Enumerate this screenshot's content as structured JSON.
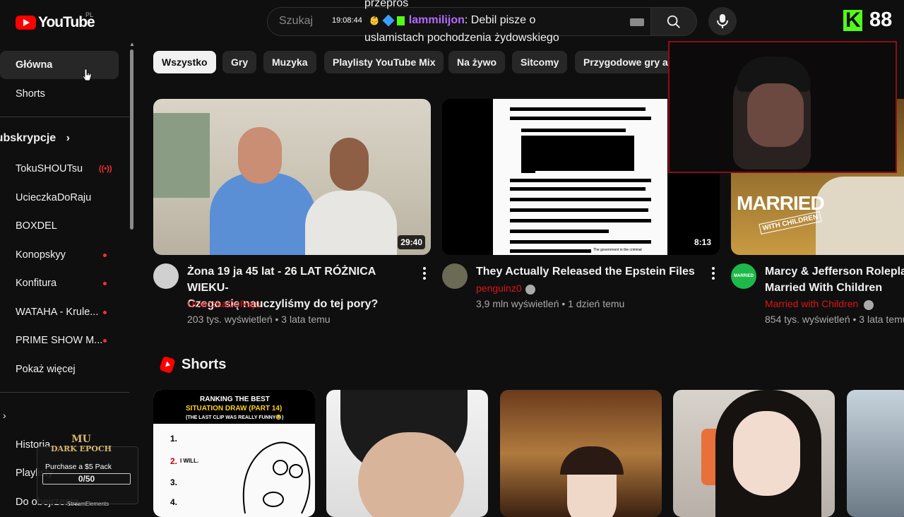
{
  "header": {
    "logo_text": "YouTube",
    "country_code": "PL",
    "search_placeholder": "Szukaj"
  },
  "chat_overlay": {
    "prev_text": "przepros",
    "time": "19:08:44",
    "username": "lammilijon",
    "message_part1": ": Debil pisze o",
    "message_part2": "uslamistach pochodzenia żydowskiego"
  },
  "kick": {
    "viewer_count": "88"
  },
  "sidebar": {
    "main": [
      {
        "label": "Główna"
      },
      {
        "label": "Shorts"
      }
    ],
    "subscriptions_header": "Subskrypcje",
    "subscriptions": [
      {
        "label": "TokuSHOUTsu",
        "status": "live"
      },
      {
        "label": "UcieczkaDoRaju",
        "status": ""
      },
      {
        "label": "BOXDEL",
        "status": ""
      },
      {
        "label": "Konopskyy",
        "status": "new"
      },
      {
        "label": "Konfitura",
        "status": "new"
      },
      {
        "label": "WATAHA - Krule...",
        "status": "new"
      },
      {
        "label": "PRIME SHOW M...",
        "status": "new"
      },
      {
        "label": "Pokaż więcej",
        "status": ""
      }
    ],
    "you": [
      {
        "label": "Historia"
      },
      {
        "label": "Playlisty"
      },
      {
        "label": "Do obejrzenia"
      }
    ]
  },
  "chips": [
    "Wszystko",
    "Gry",
    "Muzyka",
    "Playlisty YouTube Mix",
    "Na żywo",
    "Sitcomy",
    "Przygodowe gry ak"
  ],
  "videos": [
    {
      "title_line1": "Żona 19 ja 45 lat - 26 LAT RÓŻNICA WIEKU-",
      "title_line2": "Czego się nauczyliśmy do tej pory?",
      "channel": "UcieczkaDoRaju",
      "meta": "203 tys. wyświetleń • 3 lata temu",
      "duration": "29:40"
    },
    {
      "title_line1": "They Actually Released the Epstein Files",
      "title_line2": "",
      "channel": "penguinz0",
      "meta": "3,9 mln wyświetleń • 1 dzień temu",
      "duration": "8:13",
      "thumb_caption": "The government in the criminal"
    },
    {
      "title_line1": "Marcy & Jefferson Roleplay",
      "title_line2": "Married With Children",
      "channel": "Married with Children",
      "meta": "854 tys. wyświetleń • 3 lata temu",
      "thumb_text": "MARRIED",
      "thumb_subtext": "WITH CHILDREN",
      "avatar_text": "MARRIED"
    }
  ],
  "shorts": {
    "title": "Shorts",
    "first_thumb": {
      "line1": "RANKING THE BEST",
      "line2": "SITUATION DRAW (PART 14)",
      "line3": "(THE LAST CLIP WAS REALLY FUNNY😂)",
      "rank1": "1.",
      "rank2": "2.",
      "rank2_text": "I WILL.",
      "rank3": "3.",
      "rank4": "4."
    }
  },
  "widget": {
    "logo_line1": "MU",
    "logo_line2": "DARK EPOCH",
    "label": "Purchase a $5 Pack",
    "progress": "0/50",
    "footer": "StreamElements"
  },
  "colors": {
    "accent_red": "#ff0000",
    "kick_green": "#53fc18",
    "chat_user": "#b46bff"
  }
}
